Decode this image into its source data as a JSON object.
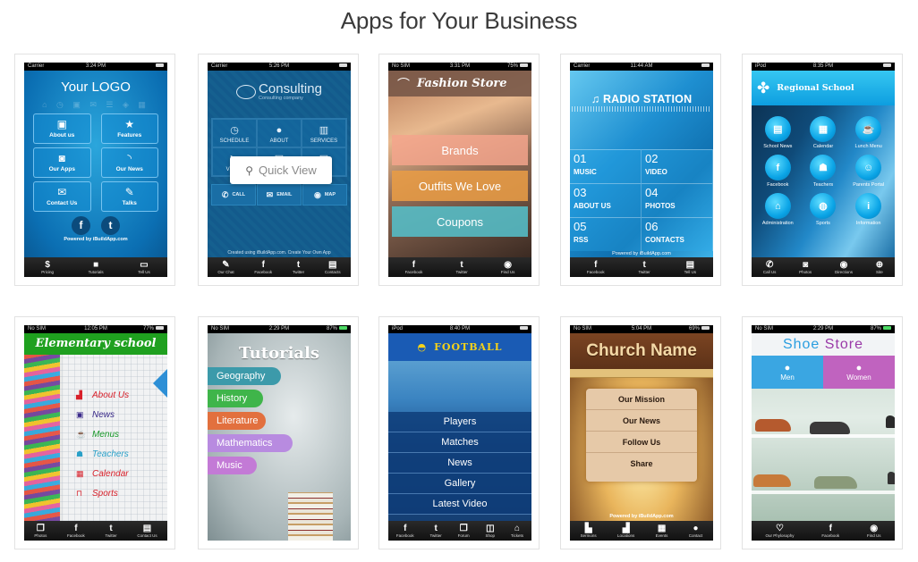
{
  "page": {
    "title": "Apps for Your Business"
  },
  "overlay": {
    "quick_view_label": "Quick View",
    "quick_view_icon": "search-icon"
  },
  "apps": [
    {
      "status": {
        "carrier": "Carrier",
        "time": "3:24 PM",
        "battery": ""
      },
      "logo": "Your LOGO",
      "buttons": [
        {
          "label": "About us",
          "icon": "devices-icon"
        },
        {
          "label": "Features",
          "icon": "star-icon"
        },
        {
          "label": "Our Apps",
          "icon": "camera-icon"
        },
        {
          "label": "Our News",
          "icon": "rss-icon"
        },
        {
          "label": "Contact Us",
          "icon": "envelope-icon"
        },
        {
          "label": "Talks",
          "icon": "edit-icon"
        }
      ],
      "powered": "Powered by iBuildApp.com",
      "tabs": [
        {
          "label": "Pricing",
          "icon": "dollar-icon"
        },
        {
          "label": "Tutorials",
          "icon": "video-icon"
        },
        {
          "label": "Tell Us",
          "icon": "chat-icon"
        }
      ]
    },
    {
      "status": {
        "carrier": "Carrier",
        "time": "5:26 PM",
        "battery": ""
      },
      "brand": "Consulting",
      "tagline": "Consulting company",
      "grid": [
        {
          "label": "SCHEDULE",
          "icon": "clock-icon"
        },
        {
          "label": "ABOUT",
          "icon": "person-icon"
        },
        {
          "label": "SERVICES",
          "icon": "book-icon"
        },
        {
          "label": "VIDEO",
          "icon": "video-icon"
        },
        {
          "label": "GALLERY",
          "icon": "image-icon"
        },
        {
          "label": "NEWS",
          "icon": "news-icon"
        }
      ],
      "actions": [
        {
          "label": "CALL",
          "icon": "phone-icon"
        },
        {
          "label": "EMAIL",
          "icon": "envelope-icon"
        },
        {
          "label": "MAP",
          "icon": "map-pin-icon"
        }
      ],
      "created": "Created using iBuildApp.com. Create Your Own App",
      "tabs": [
        {
          "label": "Our Chat",
          "icon": "edit-icon"
        },
        {
          "label": "Facebook",
          "icon": "facebook-icon"
        },
        {
          "label": "Twitter",
          "icon": "twitter-icon"
        },
        {
          "label": "Contacts",
          "icon": "contacts-icon"
        }
      ]
    },
    {
      "status": {
        "carrier": "No SIM",
        "time": "3:31 PM",
        "battery": "75%"
      },
      "title": "Fashion Store",
      "buttons": [
        "Brands",
        "Outfits We Love",
        "Coupons"
      ],
      "tabs": [
        {
          "label": "Facebook",
          "icon": "facebook-icon"
        },
        {
          "label": "Twitter",
          "icon": "twitter-icon"
        },
        {
          "label": "Find Us",
          "icon": "map-pin-icon"
        }
      ]
    },
    {
      "status": {
        "carrier": "Carrier",
        "time": "11:44 AM",
        "battery": ""
      },
      "title": "RADIO STATION",
      "items": [
        {
          "num": "01",
          "label": "MUSIC"
        },
        {
          "num": "02",
          "label": "VIDEO"
        },
        {
          "num": "03",
          "label": "ABOUT US"
        },
        {
          "num": "04",
          "label": "PHOTOS"
        },
        {
          "num": "05",
          "label": "RSS"
        },
        {
          "num": "06",
          "label": "CONTACTS"
        }
      ],
      "powered": "Powered by iBuildApp.com",
      "tabs": [
        {
          "label": "Facebook",
          "icon": "facebook-icon"
        },
        {
          "label": "Twitter",
          "icon": "twitter-icon"
        },
        {
          "label": "Tell Us",
          "icon": "document-icon"
        }
      ]
    },
    {
      "status": {
        "carrier": "iPod",
        "time": "8:35 PM",
        "battery": ""
      },
      "title": "Regional School",
      "items": [
        {
          "label": "School News",
          "icon": "news-icon"
        },
        {
          "label": "Calendar",
          "icon": "calendar-icon"
        },
        {
          "label": "Lunch Menu",
          "icon": "food-icon"
        },
        {
          "label": "Facebook",
          "icon": "facebook-icon"
        },
        {
          "label": "Teachers",
          "icon": "teacher-icon"
        },
        {
          "label": "Parents Portal",
          "icon": "parents-icon"
        },
        {
          "label": "Administration",
          "icon": "building-icon"
        },
        {
          "label": "Sports",
          "icon": "basketball-icon"
        },
        {
          "label": "Information",
          "icon": "info-icon"
        }
      ],
      "tabs": [
        {
          "label": "Call Us",
          "icon": "phone-icon"
        },
        {
          "label": "Photos",
          "icon": "camera-icon"
        },
        {
          "label": "Directions",
          "icon": "map-pin-icon"
        },
        {
          "label": "Site",
          "icon": "globe-icon"
        }
      ]
    },
    {
      "status": {
        "carrier": "No SIM",
        "time": "12:05 PM",
        "battery": "77%"
      },
      "title": "Elementary school",
      "items": [
        {
          "label": "About Us",
          "color": "#d8202a",
          "icon": "school-icon"
        },
        {
          "label": "News",
          "color": "#3a2a8a",
          "icon": "news-icon"
        },
        {
          "label": "Menus",
          "color": "#1a9a2a",
          "icon": "food-icon"
        },
        {
          "label": "Teachers",
          "color": "#2aa0c8",
          "icon": "teacher-icon"
        },
        {
          "label": "Calendar",
          "color": "#d8202a",
          "icon": "calendar-icon"
        },
        {
          "label": "Sports",
          "color": "#d8202a",
          "icon": "basketball-icon"
        }
      ],
      "tabs": [
        {
          "label": "Photos",
          "icon": "photos-icon"
        },
        {
          "label": "Facebook",
          "icon": "facebook-icon"
        },
        {
          "label": "Twitter",
          "icon": "twitter-icon"
        },
        {
          "label": "Contact Us",
          "icon": "document-icon"
        }
      ]
    },
    {
      "status": {
        "carrier": "No SIM",
        "time": "2:29 PM",
        "battery": "87%"
      },
      "title": "Tutorials",
      "items": [
        {
          "label": "Geography",
          "color": "#3c9aaa"
        },
        {
          "label": "History",
          "color": "#3fb54a"
        },
        {
          "label": "Literature",
          "color": "#e2703e"
        },
        {
          "label": "Mathematics",
          "color": "#b88be0"
        },
        {
          "label": "Music",
          "color": "#c37ad6"
        }
      ]
    },
    {
      "status": {
        "carrier": "iPod",
        "time": "8:40 PM",
        "battery": ""
      },
      "title": "FOOTBALL",
      "items": [
        "Players",
        "Matches",
        "News",
        "Gallery",
        "Latest Video"
      ],
      "tabs": [
        {
          "label": "Facebook",
          "icon": "facebook-icon"
        },
        {
          "label": "Twitter",
          "icon": "twitter-icon"
        },
        {
          "label": "Forum",
          "icon": "forum-icon"
        },
        {
          "label": "Shop",
          "icon": "shop-icon"
        },
        {
          "label": "Tickets",
          "icon": "ticket-icon"
        }
      ]
    },
    {
      "status": {
        "carrier": "No SIM",
        "time": "5:04 PM",
        "battery": "69%"
      },
      "title": "Church Name",
      "items": [
        "Our Mission",
        "Our News",
        "Follow Us",
        "Share"
      ],
      "powered": "Powered by iBuildApp.com",
      "tabs": [
        {
          "label": "Sermons",
          "icon": "book-icon"
        },
        {
          "label": "Locations",
          "icon": "building-icon"
        },
        {
          "label": "Events",
          "icon": "calendar-icon"
        },
        {
          "label": "Contact",
          "icon": "person-icon"
        }
      ]
    },
    {
      "status": {
        "carrier": "No SIM",
        "time": "2:29 PM",
        "battery": "87%"
      },
      "title_a": "Shoe",
      "title_b": "Store",
      "categories": [
        {
          "label": "Men",
          "color": "#3aa6e2"
        },
        {
          "label": "Women",
          "color": "#c063bf"
        }
      ],
      "tabs": [
        {
          "label": "Our Phylosophy",
          "icon": "heart-icon"
        },
        {
          "label": "Facebook",
          "icon": "facebook-icon"
        },
        {
          "label": "Find Us",
          "icon": "map-pin-icon"
        }
      ]
    }
  ]
}
